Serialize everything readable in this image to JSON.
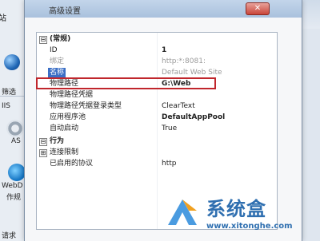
{
  "background": {
    "tab_label": "站",
    "filter_label": "筛选",
    "iis_label": "IIS",
    "asp_label": "AS",
    "webdav_label": "WebD",
    "webdav_sub": "作规",
    "bottom_label": "请求"
  },
  "dialog": {
    "title": "高级设置",
    "close_symbol": "✕"
  },
  "grid": {
    "general_category": "(常规)",
    "rows": [
      {
        "key": "ID",
        "value": "1"
      },
      {
        "key": "绑定",
        "value": "http:*:8081:"
      },
      {
        "key": "名称",
        "value": "Default Web Site"
      },
      {
        "key": "物理路径",
        "value": "G:\\Web"
      },
      {
        "key": "物理路径凭据",
        "value": ""
      },
      {
        "key": "物理路径凭据登录类型",
        "value": "ClearText"
      },
      {
        "key": "应用程序池",
        "value": "DefaultAppPool"
      },
      {
        "key": "自动启动",
        "value": "True"
      }
    ],
    "behavior_category": "行为",
    "behavior_rows": [
      {
        "key": "连接限制",
        "value": ""
      },
      {
        "key": "已启用的协议",
        "value": "http"
      }
    ]
  },
  "watermark": {
    "brand": "系统盒",
    "url": "www.xitonghe.com"
  },
  "colors": {
    "highlight_border": "#c0262c",
    "selected_row": "#3b6fc6"
  }
}
